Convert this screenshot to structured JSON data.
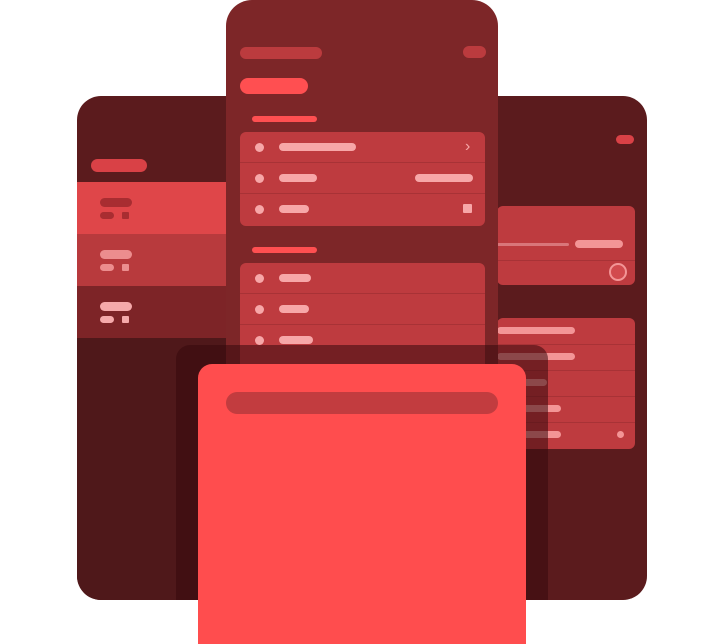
{
  "colors": {
    "back_tablet": "#5b1b1d",
    "phone": "#7d2628",
    "card": "#be3b3f",
    "accent": "#ff4d4e",
    "pale": "#f7a7a8"
  },
  "icons": {
    "chevron": "›"
  },
  "back_tablet": {
    "list_rows": [
      {
        "state": "selected"
      },
      {
        "state": "hover"
      },
      {
        "state": "default"
      }
    ]
  },
  "phone": {
    "sections": [
      {
        "rows": 3
      },
      {
        "rows": 3
      }
    ]
  },
  "sheet": {}
}
